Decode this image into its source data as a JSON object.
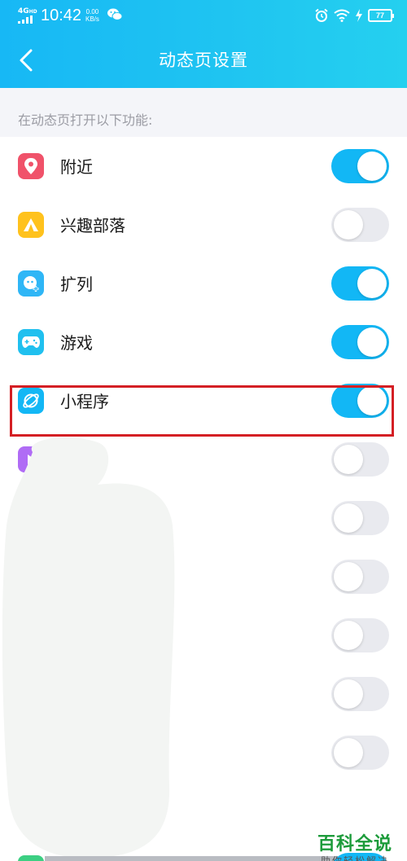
{
  "status_bar": {
    "network": "4G",
    "network_hd": "HD",
    "time": "10:42",
    "speed_value": "0.00",
    "speed_unit": "KB/s",
    "battery": "77"
  },
  "header": {
    "title": "动态页设置"
  },
  "section_label": "在动态页打开以下功能:",
  "items": [
    {
      "label": "附近",
      "icon": "location-pin-icon",
      "color": "#f0526a",
      "on": true
    },
    {
      "label": "兴趣部落",
      "icon": "tent-icon",
      "color": "#ffc21d",
      "on": false
    },
    {
      "label": "扩列",
      "icon": "add-friend-icon",
      "color": "#2fb6f6",
      "on": true
    },
    {
      "label": "游戏",
      "icon": "gamepad-icon",
      "color": "#20c0ef",
      "on": true
    },
    {
      "label": "小程序",
      "icon": "planet-icon",
      "color": "#12b7f5",
      "on": true
    },
    {
      "label": "",
      "icon": "play-icon",
      "color": "#b06cf5",
      "on": false
    },
    {
      "label": "",
      "icon": "",
      "color": "",
      "on": false
    },
    {
      "label": "",
      "icon": "",
      "color": "",
      "on": false
    },
    {
      "label": "",
      "icon": "",
      "color": "",
      "on": false
    },
    {
      "label": "",
      "icon": "",
      "color": "",
      "on": false
    },
    {
      "label": "",
      "icon": "",
      "color": "",
      "on": false
    }
  ],
  "watermark": {
    "title": "百科全说",
    "subtitle": "助你轻松解决"
  },
  "colors": {
    "accent": "#12b7f5",
    "toggle_off": "#e9eaef",
    "highlight": "#d41f24"
  }
}
